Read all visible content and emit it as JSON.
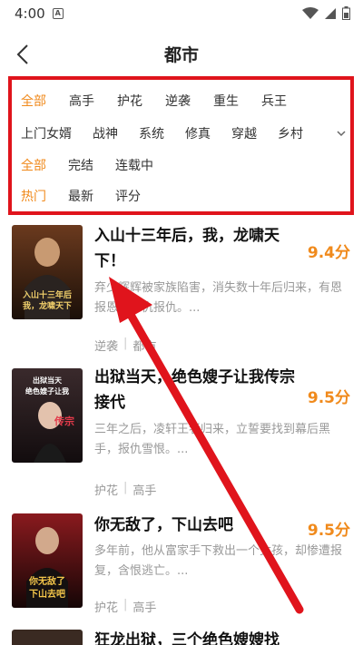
{
  "status_bar": {
    "time": "4:00",
    "notif_letter": "A"
  },
  "nav": {
    "title": "都市"
  },
  "filters": {
    "row1": [
      "全部",
      "高手",
      "护花",
      "逆袭",
      "重生",
      "兵王"
    ],
    "row2": [
      "上门女婿",
      "战神",
      "系统",
      "修真",
      "穿越",
      "乡村"
    ],
    "row3": [
      "全部",
      "完结",
      "连载中"
    ],
    "row4": [
      "热门",
      "最新",
      "评分"
    ],
    "active_color": "#f08a1c"
  },
  "books": [
    {
      "title": "入山十三年后，我，龙啸天下！",
      "score": "9.4分",
      "desc": "弃少辉辉被家族陷害，消失数十年后归来，有恩报恩，有仇报仇。...",
      "tags": [
        "逆袭",
        "都市"
      ],
      "cover_text": "入山十三年后 我，龙啸天下"
    },
    {
      "title": "出狱当天，绝色嫂子让我传宗接代",
      "score": "9.5分",
      "desc": "三年之后，凌轩王者归来，立誓要找到幕后黑手，报仇雪恨。...",
      "tags": [
        "护花",
        "高手"
      ],
      "cover_text": "出狱当天 绝色嫂子让我 传宗接代"
    },
    {
      "title": "你无敌了，下山去吧",
      "score": "9.5分",
      "desc": "多年前，他从富家手下救出一个女孩，却惨遭报复，含恨逃亡。...",
      "tags": [
        "护花",
        "高手"
      ],
      "cover_text": "你无敌了 下山去吧"
    },
    {
      "title": "狂龙出狱，三个绝色嫂嫂找",
      "score": "",
      "desc": "",
      "tags": [],
      "cover_text": ""
    }
  ],
  "colors": {
    "highlight_box": "#e0141c",
    "score": "#f08a1c"
  }
}
